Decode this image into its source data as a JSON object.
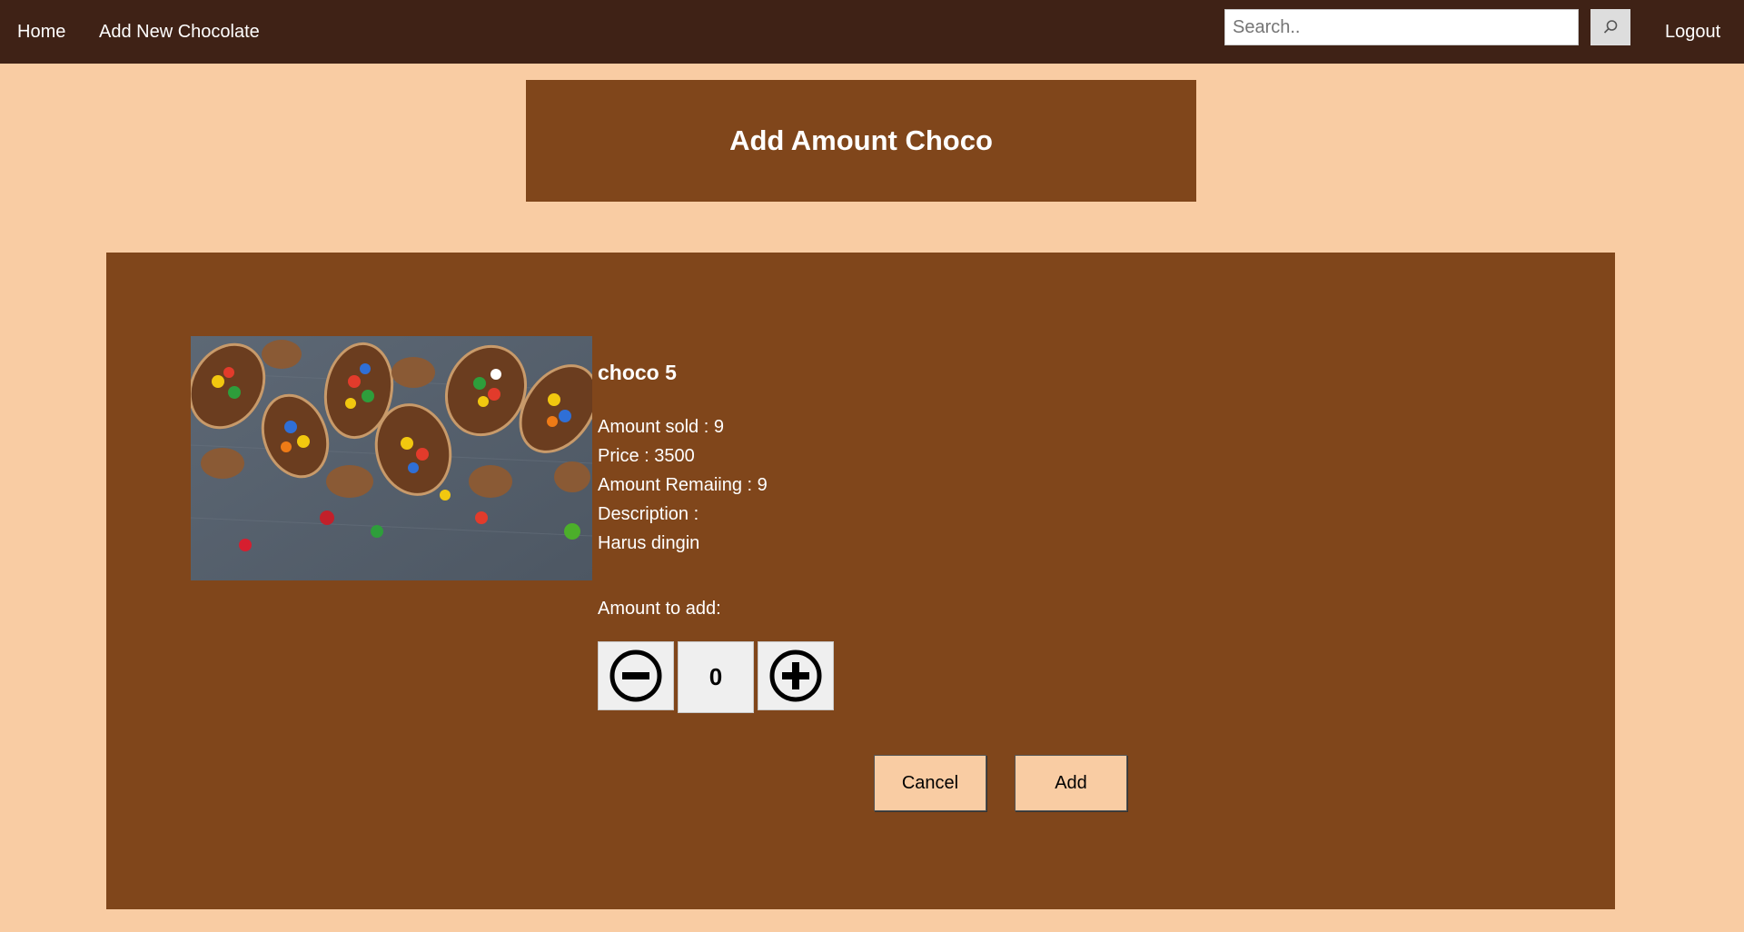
{
  "nav": {
    "home_label": "Home",
    "add_new_label": "Add New Chocolate",
    "search_placeholder": "Search..",
    "logout_label": "Logout"
  },
  "page": {
    "title": "Add Amount Choco"
  },
  "product": {
    "name": "choco 5",
    "amount_sold": "Amount sold : 9",
    "price": "Price : 3500",
    "amount_remaining": "Amount Remaiing : 9",
    "description_label": "Description :",
    "description": "Harus dingin",
    "image_icon": "chocolate-eggs-image"
  },
  "form": {
    "amount_label": "Amount to add:",
    "amount_value": "0",
    "decrement_icon": "minus-circle-icon",
    "increment_icon": "plus-circle-icon",
    "cancel_label": "Cancel",
    "add_label": "Add"
  },
  "colors": {
    "navbar": "#3f2216",
    "background": "#f9cca3",
    "panel": "#80461b",
    "text": "#ffffff"
  }
}
